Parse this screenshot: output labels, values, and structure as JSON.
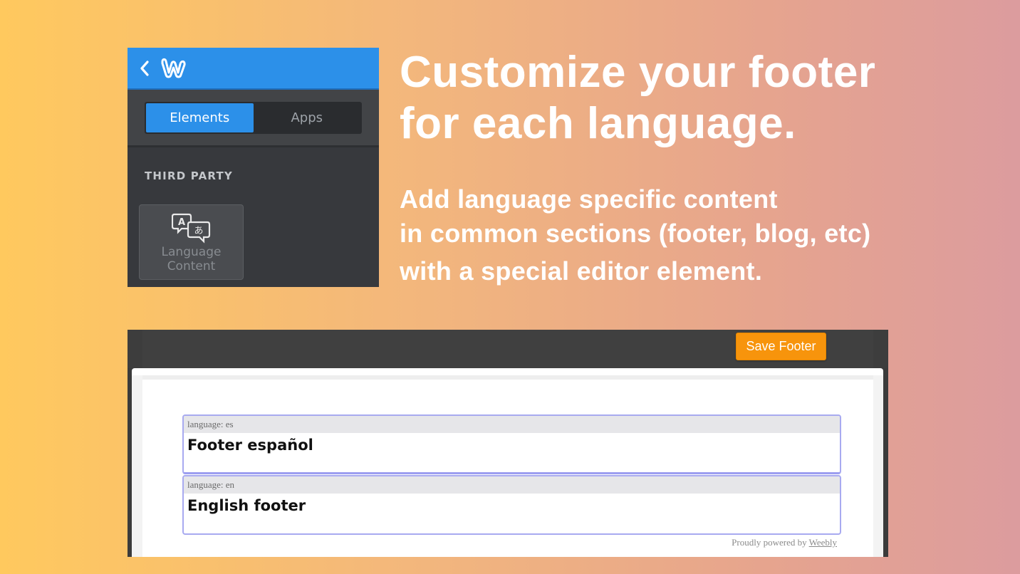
{
  "panel": {
    "tabs": [
      {
        "label": "Elements",
        "active": true
      },
      {
        "label": "Apps",
        "active": false
      }
    ],
    "section_label": "THIRD PARTY",
    "element_tile": {
      "label_line1": "Language",
      "label_line2": "Content",
      "icon": "language-translate-icon"
    },
    "icons": {
      "back": "chevron-left-icon",
      "logo": "weebly-logo-icon"
    }
  },
  "headline": {
    "line1": "Customize your footer",
    "line2": "for each language."
  },
  "subline": {
    "line1": "Add language specific content",
    "line2": "in common sections (footer, blog, etc)",
    "line3": "with a special editor element."
  },
  "editor": {
    "save_button": "Save Footer",
    "blocks": [
      {
        "tag": "language: es",
        "content": "Footer español"
      },
      {
        "tag": "language: en",
        "content": "English footer"
      }
    ],
    "powered_prefix": "Proudly powered by",
    "powered_link": "Weebly"
  },
  "colors": {
    "accent_blue": "#2c90e9",
    "save_orange": "#f7940c",
    "block_border": "#a8aaf0"
  }
}
